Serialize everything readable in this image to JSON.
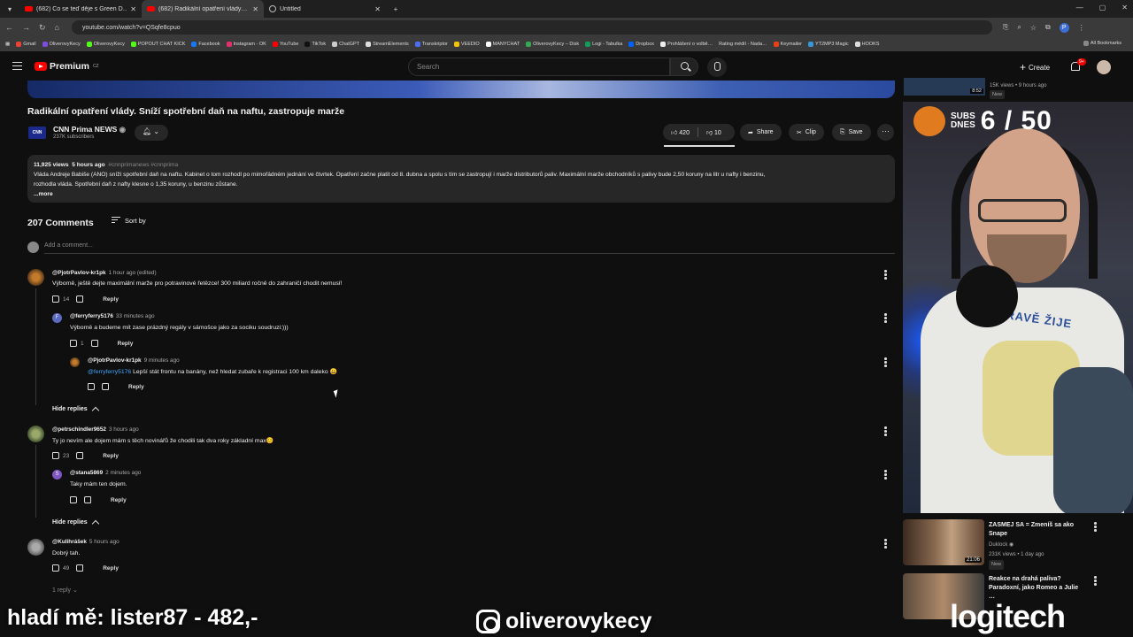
{
  "browser": {
    "tabs": [
      {
        "title": "(682) Co se teď děje s Green D…",
        "active": false
      },
      {
        "title": "(682) Radikální opatření vlády…",
        "active": true
      },
      {
        "title": "Untitled",
        "active": false
      }
    ],
    "url": "youtube.com/watch?v=QSqfe8cpuo",
    "profile_initial": "P",
    "bookmarks": [
      "Gmail",
      "OliverovyKecy",
      "OliverovyKecy",
      "POPOUT CHAT KICK",
      "Facebook",
      "Instagram - OK",
      "YouTube",
      "TikTok",
      "ChatGPT",
      "StreamElements",
      "Transkriptor",
      "VEEDIO",
      "MANYCHAT",
      "OliverovyKecy – Disk",
      "Logi - Tabulka",
      "Dropbox",
      "Prohlášení o volbě…",
      "Rating médií - Nada…",
      "Keymailer",
      "YT2MP3 Magic",
      "HOOKS"
    ],
    "all_bookmarks": "All Bookmarks"
  },
  "youtube": {
    "logo": "Premium",
    "country": "CZ",
    "search_placeholder": "Search",
    "create": "Create",
    "notif_count": "9+"
  },
  "video": {
    "title": "Radikální opatření vlády. Sníží spotřební daň na naftu, zastropuje marže",
    "channel": "CNN Prima NEWS",
    "channel_logo_text": "CNN",
    "subscribers": "237K subscribers",
    "likes": "420",
    "dislikes": "10",
    "share": "Share",
    "clip": "Clip",
    "save": "Save"
  },
  "description": {
    "views": "11,925 views",
    "time": "5 hours ago",
    "tags": "#cnnprimanews #cnnprima",
    "line1": "Vláda Andreje Babiše (ANO) sníží spotřební daň na naftu. Kabinet o tom rozhodl po mimořádném jednání ve čtvrtek. Opatření začne platit od 8. dubna a spolu s tím se zastropují i marže distributorů paliv. Maximální marže obchodníků s palivy bude 2,50 koruny na litr u nafty i benzinu,",
    "line2": "rozhodla vláda. Spotřební daň z nafty klesne o 1,35 koruny, u benzinu zůstane.",
    "more": "...more"
  },
  "comments_header": {
    "count": "207 Comments",
    "sort": "Sort by",
    "add_placeholder": "Add a comment..."
  },
  "comments": [
    {
      "author": "@PjotrPavlov-kr1pk",
      "time": "1 hour ago (edited)",
      "text": "Výborně, ještě dejte maximální marže pro potravinové řetězce! 300 miliard ročně do zahraničí chodit nemusí!",
      "likes": "14",
      "reply": "Reply"
    },
    {
      "author": "@ferryferry5176",
      "time": "33 minutes ago",
      "text": "Výborně a budeme mít zase prázdný regály v sámošce jako za sociku soudruzi:)))",
      "likes": "1",
      "reply": "Reply",
      "avatar_letter": "F"
    },
    {
      "author": "@PjotrPavlov-kr1pk",
      "time": "9 minutes ago",
      "mention": "@ferryferry5176",
      "text": " Lepší stát frontu na banány, než hledat zubaře k registraci 100 km daleko 😀",
      "reply": "Reply"
    },
    {
      "author": "@petrschindler9652",
      "time": "3 hours ago",
      "text": "Ty jo nevím ale dojem mám s těch novinářů že chodili tak dva roky základní max😊",
      "likes": "23",
      "reply": "Reply"
    },
    {
      "author": "@stana5869",
      "time": "2 minutes ago",
      "text": "Taky mám ten dojem.",
      "reply": "Reply",
      "avatar_letter": "S"
    },
    {
      "author": "@Kulihrášek",
      "time": "5 hours ago",
      "text": "Dobrý tah.",
      "likes": "49",
      "reply": "Reply"
    }
  ],
  "hide_replies": "Hide replies",
  "one_reply": "1 reply",
  "sidebar": {
    "top_meta_views": "15K views • 9 hours ago",
    "top_new": "New",
    "top_duration": "8:52",
    "subs_goal_label_1": "SUBS",
    "subs_goal_label_2": "DNES",
    "subs_goal": "6 / 50",
    "shirt_text": "ZDRAVĚ ŽIJE",
    "videos": [
      {
        "title": "ZASMEJ SA = Zmeníš sa ako Snape",
        "channel": "Duklock",
        "meta": "231K views • 1 day ago",
        "badge": "New",
        "duration": "21:06"
      },
      {
        "title": "Reakce na drahá paliva? Paradoxní, jako Romeo a Julie …",
        "channel": "",
        "meta": "",
        "badge": "",
        "duration": ""
      }
    ]
  },
  "overlay": {
    "left_text": "hladí mě: lister87 - 482,-",
    "instagram": "oliverovykecy",
    "brand": "logitech"
  },
  "colors": {
    "background": "#0f0f0f",
    "youtube_red": "#ff0000",
    "link_blue": "#3ea6ff"
  }
}
